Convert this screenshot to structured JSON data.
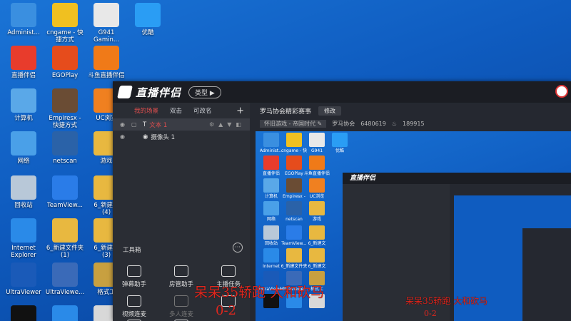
{
  "desktop": {
    "icons": [
      {
        "label": "Administ...",
        "color": "#3a8fe0"
      },
      {
        "label": "cngame - 快\n捷方式",
        "color": "#f0c020"
      },
      {
        "label": "G941\nGamin...",
        "color": "#e8e8e8"
      },
      {
        "label": "优酷",
        "color": "#2a9df4"
      },
      {
        "label": "直播伴侣",
        "color": "#e83c2c"
      },
      {
        "label": "EGOPlay",
        "color": "#e64c1c"
      },
      {
        "label": "斗鱼直播伴侣",
        "color": "#f07a18"
      },
      {
        "label": "计算机",
        "color": "#5aa8e8"
      },
      {
        "label": "Empiresx -\n快捷方式",
        "color": "#6a4c34"
      },
      {
        "label": "UC浏览",
        "color": "#f08020"
      },
      {
        "label": "网络",
        "color": "#4aa0e8"
      },
      {
        "label": "netscan",
        "color": "#2a62a8"
      },
      {
        "label": "游戏",
        "color": "#e8b840"
      },
      {
        "label": "回收站",
        "color": "#b8c8d8"
      },
      {
        "label": "TeamView...",
        "color": "#2a7ce8"
      },
      {
        "label": "6_新建文\n(4)",
        "color": "#e8b840"
      },
      {
        "label": "Internet\nExplorer",
        "color": "#2a8ae8"
      },
      {
        "label": "6_新建文件夹\n(1)",
        "color": "#e8b840"
      },
      {
        "label": "6_新建文\n(3)",
        "color": "#e8b840"
      },
      {
        "label": "UltraViewer",
        "color": "#1a5ab8"
      },
      {
        "label": "UltraViewe...",
        "color": "#3a6ab8"
      },
      {
        "label": "格式工",
        "color": "#c8a040"
      },
      {
        "label": "",
        "color": "#111111"
      },
      {
        "label": "",
        "color": "#2a8ae8"
      },
      {
        "label": "",
        "color": "#d8d8d8"
      }
    ]
  },
  "app": {
    "logo": "直播伴侣",
    "type_button": "类型 ▶",
    "scene_tabs": [
      "我的场景",
      "双击",
      "可改名"
    ],
    "sources": [
      {
        "label": "文本 1",
        "icon": "T"
      },
      {
        "label": "摄像头 1",
        "icon": "◉"
      }
    ],
    "toolbox_title": "工具箱",
    "tools": [
      {
        "label": "弹幕助手"
      },
      {
        "label": "房管助手"
      },
      {
        "label": "主播任务"
      },
      {
        "label": "视频连麦"
      },
      {
        "label": "多人连麦"
      },
      {
        "label": ""
      },
      {
        "label": ""
      },
      {
        "label": ""
      }
    ],
    "room_title": "罗马协会精彩赛事",
    "edit_button": "修改",
    "category": "怀旧游戏 - 帝国时代 ✎",
    "host_name": "罗马协会",
    "room_id": "6480619",
    "heat": "189915"
  },
  "overlay": {
    "text": "呆呆35轿跑  大和砍马",
    "score": "0-2",
    "text_small": "呆呆35轿跑  大和砍马",
    "score_small": "0-2"
  },
  "colors": {
    "accent": "#e04e4e",
    "overlay": "#e0271e"
  }
}
